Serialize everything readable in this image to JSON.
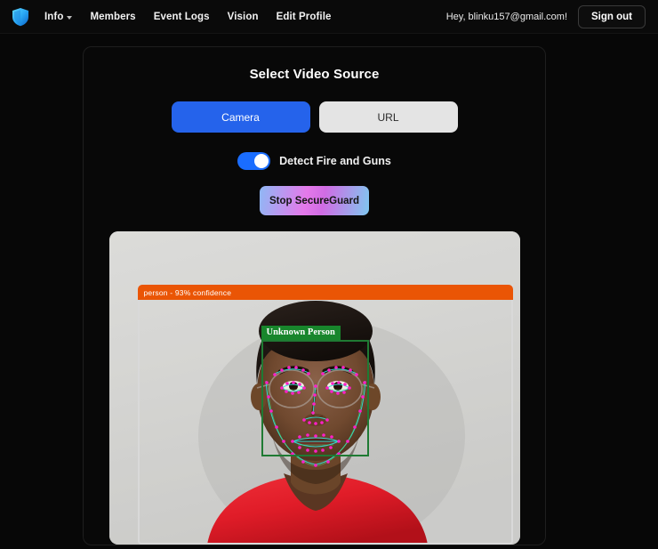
{
  "navbar": {
    "logo_icon": "shield-icon",
    "links": [
      {
        "label": "Info",
        "has_caret": true
      },
      {
        "label": "Members",
        "has_caret": false
      },
      {
        "label": "Event Logs",
        "has_caret": false
      },
      {
        "label": "Vision",
        "has_caret": false
      },
      {
        "label": "Edit Profile",
        "has_caret": false
      }
    ],
    "greeting": "Hey, blinku157@gmail.com!",
    "signout_label": "Sign out"
  },
  "panel": {
    "title": "Select Video Source",
    "sources": [
      {
        "label": "Camera",
        "selected": true
      },
      {
        "label": "URL",
        "selected": false
      }
    ],
    "toggle": {
      "label": "Detect Fire and Guns",
      "state": "on"
    },
    "action_button": {
      "label": "Stop SecureGuard"
    }
  },
  "video": {
    "detections": [
      {
        "label": "person - 93% confidence",
        "class": "person",
        "confidence": "93%",
        "color": "#ea5505"
      },
      {
        "label": "Unknown Person",
        "class": "face",
        "color": "#18862c"
      }
    ]
  },
  "colors": {
    "accent_blue": "#2563eb",
    "toggle_on": "#1a6dff",
    "person_box": "#ea5505",
    "face_box": "#18862c",
    "page_bg": "#070707"
  }
}
